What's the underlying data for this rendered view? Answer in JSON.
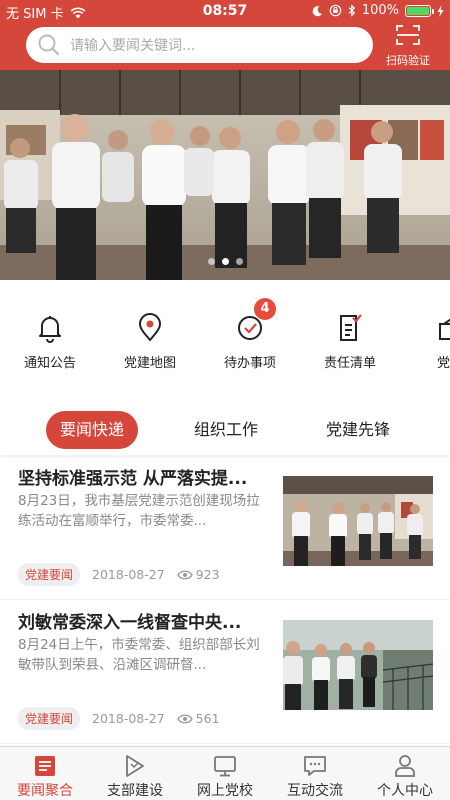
{
  "status_bar": {
    "carrier": "无 SIM 卡",
    "time": "08:57",
    "battery": "100%",
    "battery_level": 1.0
  },
  "header": {
    "search_placeholder": "请输入要闻关键词...",
    "scan_label": "扫码验证"
  },
  "banner": {
    "slide_count": 3,
    "active_slide": 1
  },
  "quick_menu": [
    {
      "label": "通知公告",
      "icon": "bell-icon"
    },
    {
      "label": "党建地图",
      "icon": "map-pin-icon"
    },
    {
      "label": "待办事项",
      "icon": "todo-check-icon",
      "badge": "4"
    },
    {
      "label": "责任清单",
      "icon": "checklist-icon"
    },
    {
      "label": "党费",
      "icon": "wallet-icon"
    }
  ],
  "tabs": [
    {
      "label": "要闻快递",
      "active": true
    },
    {
      "label": "组织工作",
      "active": false
    },
    {
      "label": "党建先锋",
      "active": false
    }
  ],
  "news": [
    {
      "title": "坚持标准强示范 从严落实提...",
      "summary": "8月23日，我市基层党建示范创建现场拉练活动在富顺举行，市委常委...",
      "tag": "党建要闻",
      "date": "2018-08-27",
      "views": "923"
    },
    {
      "title": "刘敏常委深入一线督查中央...",
      "summary": "8月24日上午，市委常委、组织部部长刘敏带队到荣县、沿滩区调研督...",
      "tag": "党建要闻",
      "date": "2018-08-27",
      "views": "561"
    }
  ],
  "bottom_nav": [
    {
      "label": "要闻聚合",
      "icon": "news-icon",
      "active": true
    },
    {
      "label": "支部建设",
      "icon": "flag-icon",
      "active": false
    },
    {
      "label": "网上党校",
      "icon": "monitor-icon",
      "active": false
    },
    {
      "label": "互动交流",
      "icon": "chat-icon",
      "active": false
    },
    {
      "label": "个人中心",
      "icon": "person-icon",
      "active": false
    }
  ],
  "colors": {
    "brand_red": "#d6473b",
    "badge_red": "#e84a3b"
  }
}
